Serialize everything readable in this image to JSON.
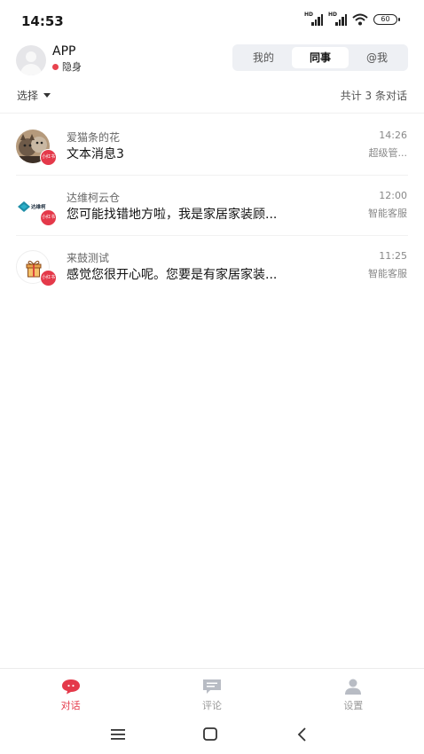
{
  "status_bar": {
    "time": "14:53",
    "battery": "60"
  },
  "header": {
    "app_name": "APP",
    "presence": "隐身",
    "tabs": [
      {
        "label": "我的",
        "active": false
      },
      {
        "label": "同事",
        "active": true
      },
      {
        "label": "@我",
        "active": false
      }
    ]
  },
  "toolbar": {
    "select_label": "选择",
    "count_label": "共计 3 条对话"
  },
  "conversations": [
    {
      "name": "爱猫条的花",
      "message": "文本消息3",
      "time": "14:26",
      "agent": "超级管...",
      "avatar": "cat-photo",
      "badge": "小红书"
    },
    {
      "name": "达维柯云仓",
      "message": "您可能找错地方啦，我是家居家装顾...",
      "time": "12:00",
      "agent": "智能客服",
      "avatar": "davico-logo",
      "avatar_text": "达维柯",
      "badge": "小红书"
    },
    {
      "name": "来鼓测试",
      "message": "感觉您很开心呢。您要是有家居家装...",
      "time": "11:25",
      "agent": "智能客服",
      "avatar": "gift-icon",
      "badge": "小红书"
    }
  ],
  "tabbar": [
    {
      "label": "对话",
      "icon": "chat-bubble-icon",
      "active": true
    },
    {
      "label": "评论",
      "icon": "comment-icon",
      "active": false
    },
    {
      "label": "设置",
      "icon": "person-icon",
      "active": false
    }
  ],
  "colors": {
    "accent": "#e4394a",
    "segment_bg": "#eef0f4"
  }
}
